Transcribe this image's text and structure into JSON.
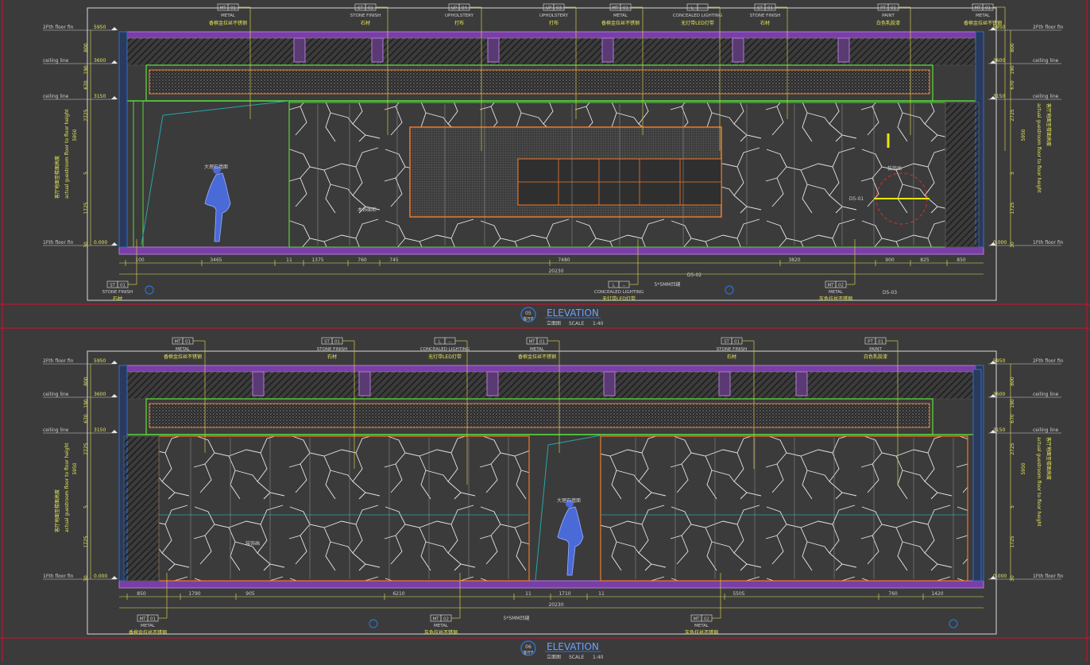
{
  "drawings": [
    {
      "id": "top",
      "number": "05",
      "title": "ELEVATION",
      "title_cn": "立面图",
      "ref_cn": "客厅E",
      "scale_label": "SCALE",
      "scale_value": "1:40",
      "level_labels_left": [
        "2Fth floor fin",
        "ceiling line",
        "ceiling line",
        "1Fth floor fin"
      ],
      "level_labels_right": [
        "2Fth floor fin",
        "ceiling line",
        "ceiling line",
        "1Fth floor fin"
      ],
      "level_vals": [
        "5950",
        "3600",
        "3150",
        "0.000"
      ],
      "vertical_dims": [
        "800",
        "190",
        "670",
        "2725",
        "5",
        "1725",
        "30"
      ],
      "vertical_side_text": [
        "客厅地面至楼面高度",
        "actual guestroom floor to floor height"
      ],
      "tags_top": [
        {
          "code": "MT",
          "num": "01",
          "name": "METAL",
          "cn": "香槟金拉丝不锈钢"
        },
        {
          "code": "ST",
          "num": "01",
          "name": "STONE FINISH",
          "cn": "石材"
        },
        {
          "code": "UP",
          "num": "04",
          "name": "UPHOLSTERY",
          "cn": "打布"
        },
        {
          "code": "UP",
          "num": "03",
          "name": "UPHOLSTERY",
          "cn": "打布"
        },
        {
          "code": "MT",
          "num": "01",
          "name": "METAL",
          "cn": "香槟金拉丝不锈钢"
        },
        {
          "code": "L",
          "num": "--",
          "name": "CONCEALED LIGHTING",
          "cn": "无灯带LED灯带"
        },
        {
          "code": "ST",
          "num": "01",
          "name": "STONE FINISH",
          "cn": "石材"
        },
        {
          "code": "PT",
          "num": "01",
          "name": "PAINT",
          "cn": "白色乳胶漆"
        },
        {
          "code": "MT",
          "num": "01",
          "name": "METAL",
          "cn": "香槟金拉丝不锈钢"
        }
      ],
      "tags_bottom": [
        {
          "code": "ST",
          "num": "01",
          "name": "STONE FINISH",
          "cn": "石材"
        },
        {
          "code": "L",
          "num": "--",
          "name": "CONCEALED LIGHTING",
          "cn": "无灯带LED灯带"
        },
        {
          "code": "MT",
          "num": "02",
          "name": "METAL",
          "cn": "灰色拉丝不锈钢"
        }
      ],
      "bottom_dims": [
        "100",
        "3465",
        "11",
        "1375",
        "760",
        "745",
        "7480",
        "3820",
        "900",
        "825",
        "850"
      ],
      "total_dim": "20230",
      "misc_notes": [
        "5*5MM凹缝",
        "D5-02",
        "D5-03",
        "D5-01"
      ],
      "callouts": [
        "大理石墙面",
        "木饰面柜",
        "装饰画"
      ]
    },
    {
      "id": "bottom",
      "number": "06",
      "title": "ELEVATION",
      "title_cn": "立面图",
      "ref_cn": "客厅F",
      "scale_label": "SCALE",
      "scale_value": "1:40",
      "level_labels_left": [
        "2Fth floor fin",
        "ceiling line",
        "ceiling line",
        "1Fth floor fin"
      ],
      "level_labels_right": [
        "2Fth floor fin",
        "ceiling line",
        "ceiling line",
        "1Fth floor fin"
      ],
      "level_vals": [
        "5950",
        "3600",
        "3150",
        "0.000"
      ],
      "vertical_dims": [
        "800",
        "190",
        "670",
        "2725",
        "5",
        "1725",
        "30"
      ],
      "vertical_side_text": [
        "客厅地面至楼面高度",
        "actual guestroom floor to floor height"
      ],
      "tags_top": [
        {
          "code": "MT",
          "num": "01",
          "name": "METAL",
          "cn": "香槟金拉丝不锈钢"
        },
        {
          "code": "ST",
          "num": "01",
          "name": "STONE FINISH",
          "cn": "石材"
        },
        {
          "code": "L",
          "num": "--",
          "name": "CONCEALED LIGHTING",
          "cn": "无灯带LED灯带"
        },
        {
          "code": "MT",
          "num": "01",
          "name": "METAL",
          "cn": "香槟金拉丝不锈钢"
        },
        {
          "code": "ST",
          "num": "01",
          "name": "STONE FINISH",
          "cn": "石材"
        },
        {
          "code": "PT",
          "num": "01",
          "name": "PAINT",
          "cn": "白色乳胶漆"
        }
      ],
      "tags_bottom": [
        {
          "code": "MT",
          "num": "01",
          "name": "METAL",
          "cn": "香槟金拉丝不锈钢"
        },
        {
          "code": "MT",
          "num": "02",
          "name": "METAL",
          "cn": "灰色拉丝不锈钢"
        },
        {
          "code": "MT",
          "num": "02",
          "name": "METAL",
          "cn": "灰色拉丝不锈钢"
        }
      ],
      "bottom_dims": [
        "850",
        "1790",
        "905",
        "6210",
        "11",
        "1710",
        "11",
        "5505",
        "760",
        "1420"
      ],
      "total_dim": "20230",
      "misc_notes": [
        "5*5MM凹缝"
      ],
      "callouts": [
        "大理石墙面",
        "装饰画"
      ]
    }
  ],
  "colors": {
    "background": "#3b3b3b",
    "frame": "#d8d8d8",
    "red_border": "#c8102e",
    "slab": "#7a3fa6",
    "ceiling_green": "#58d63a",
    "orange": "#f07a2a",
    "dim_yellow": "#e8e85a",
    "leader": "#d4c84a",
    "blue_col": "#2f6fd0",
    "teal": "#2aa6a6",
    "white_line": "#cfcfcf",
    "figure": "#4a6ad8"
  }
}
